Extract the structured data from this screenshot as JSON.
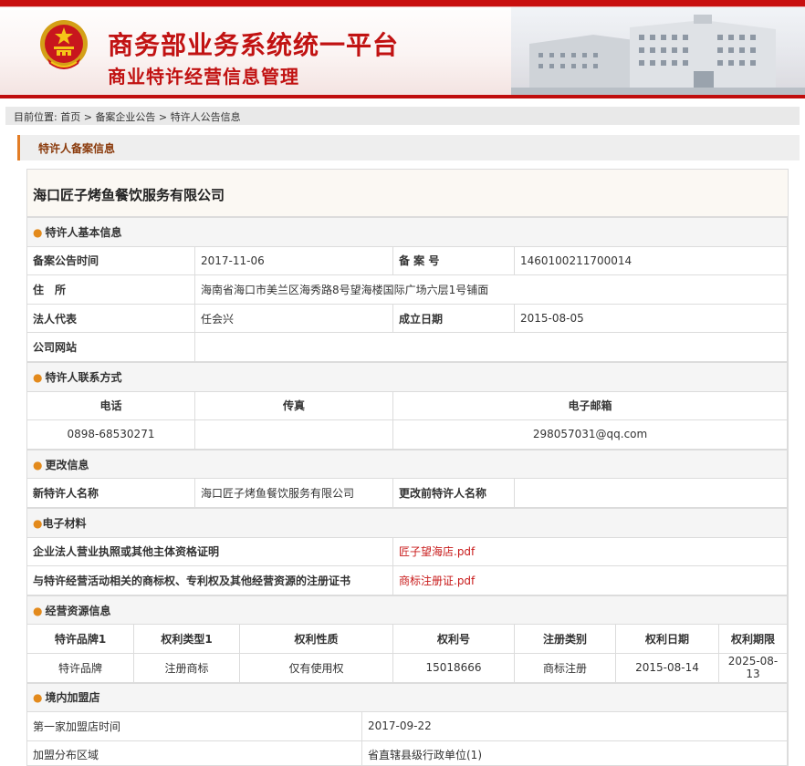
{
  "header": {
    "title_main": "商务部业务系统统一平台",
    "title_sub": "商业特许经营信息管理"
  },
  "breadcrumb": {
    "prefix": "目前位置:",
    "items": [
      "首页",
      "备案企业公告",
      "特许人公告信息"
    ],
    "sep": " > "
  },
  "section_title": "特许人备案信息",
  "company_name": "海口匠子烤鱼餐饮服务有限公司",
  "basic": {
    "group_title": "特许人基本信息",
    "announce_time_label": "备案公告时间",
    "announce_time": "2017-11-06",
    "record_no_label": "备 案 号",
    "record_no": "1460100211700014",
    "address_label": "住　所",
    "address": "海南省海口市美兰区海秀路8号望海楼国际广场六层1号铺面",
    "legal_rep_label": "法人代表",
    "legal_rep": "任会兴",
    "founded_label": "成立日期",
    "founded": "2015-08-05",
    "website_label": "公司网站",
    "website": ""
  },
  "contact": {
    "group_title": "特许人联系方式",
    "phone_label": "电话",
    "fax_label": "传真",
    "email_label": "电子邮箱",
    "phone": "0898-68530271",
    "fax": "",
    "email": "298057031@qq.com"
  },
  "change": {
    "group_title": "更改信息",
    "new_name_label": "新特许人名称",
    "new_name": "海口匠子烤鱼餐饮服务有限公司",
    "old_name_label": "更改前特许人名称",
    "old_name": ""
  },
  "materials": {
    "group_title": "电子材料",
    "license_label": "企业法人营业执照或其他主体资格证明",
    "license_file": "匠子望海店.pdf",
    "trademark_label": "与特许经营活动相关的商标权、专利权及其他经营资源的注册证书",
    "trademark_file": "商标注册证.pdf"
  },
  "resources": {
    "group_title": "经营资源信息",
    "columns": [
      "特许品牌1",
      "权利类型1",
      "权利性质",
      "权利号",
      "注册类别",
      "权利日期",
      "权利期限"
    ],
    "row": [
      "特许品牌",
      "注册商标",
      "仅有使用权",
      "15018666",
      "商标注册",
      "2015-08-14",
      "2025-08-13"
    ]
  },
  "stores": {
    "group_title": "境内加盟店",
    "first_store_label": "第一家加盟店时间",
    "first_store": "2017-09-22",
    "area_label": "加盟分布区域",
    "area": "省直辖县级行政单位(1)"
  },
  "colors": {
    "brand_red": "#c11212",
    "accent_orange": "#e37d26",
    "link_red": "#c81919"
  }
}
